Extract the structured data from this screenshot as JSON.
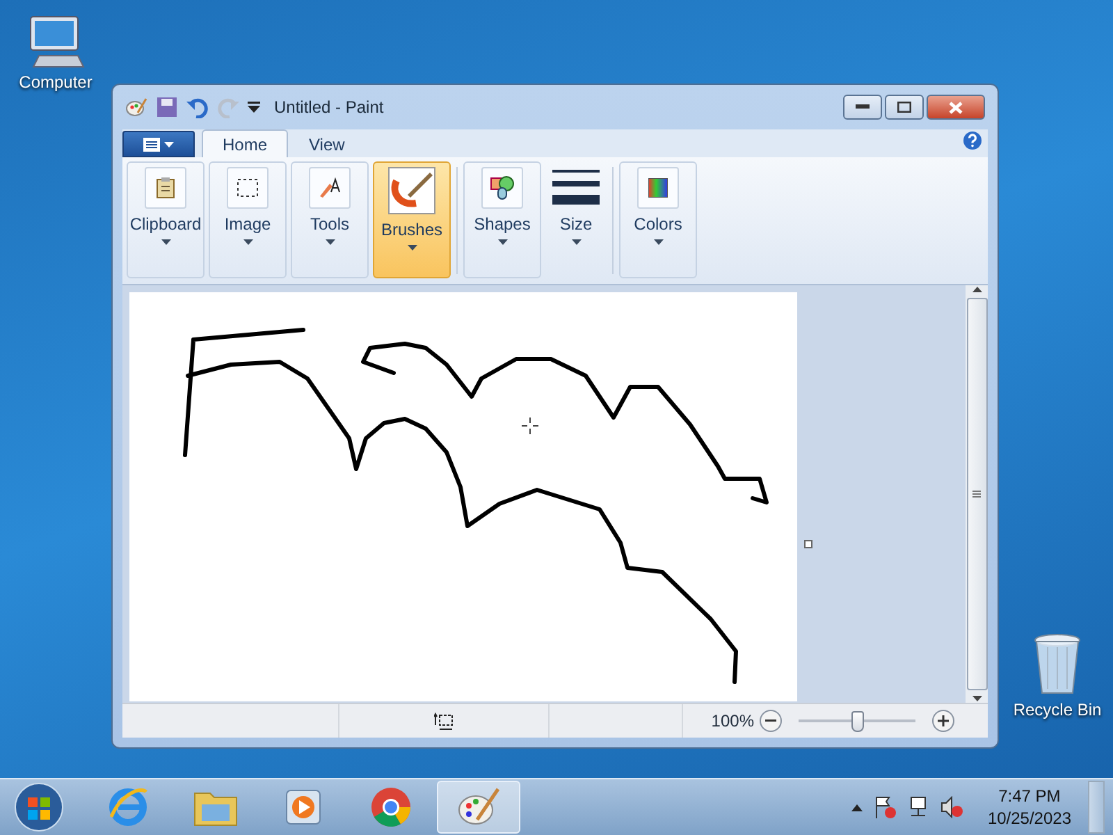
{
  "desktop_icons": [
    {
      "kind": "computer",
      "label": "Computer"
    },
    {
      "kind": "recycle_bin",
      "label": "Recycle Bin"
    }
  ],
  "window": {
    "title": "Untitled - Paint",
    "tabs": [
      {
        "label": "Home",
        "selected": true
      },
      {
        "label": "View",
        "selected": false
      }
    ],
    "ribbon_groups": [
      {
        "kind": "clipboard",
        "label": "Clipboard",
        "selected": false
      },
      {
        "kind": "image",
        "label": "Image",
        "selected": false
      },
      {
        "kind": "tools",
        "label": "Tools",
        "selected": false
      },
      {
        "kind": "brushes",
        "label": "Brushes",
        "selected": true
      },
      {
        "kind": "shapes",
        "label": "Shapes",
        "selected": false
      },
      {
        "kind": "size",
        "label": "Size",
        "selected": false
      },
      {
        "kind": "colors",
        "label": "Colors",
        "selected": false
      }
    ],
    "status_bar": {
      "zoom": "100%",
      "zoom_slider": {
        "level": 0.5
      }
    }
  },
  "taskbar": {
    "apps": [
      {
        "kind": "browser_e",
        "selected": false
      },
      {
        "kind": "folders",
        "selected": false
      },
      {
        "kind": "media",
        "selected": false
      },
      {
        "kind": "chrome",
        "selected": false
      },
      {
        "kind": "paint",
        "selected": true
      }
    ],
    "clock": {
      "time": "7:47 PM",
      "date": "10/25/2023"
    }
  }
}
